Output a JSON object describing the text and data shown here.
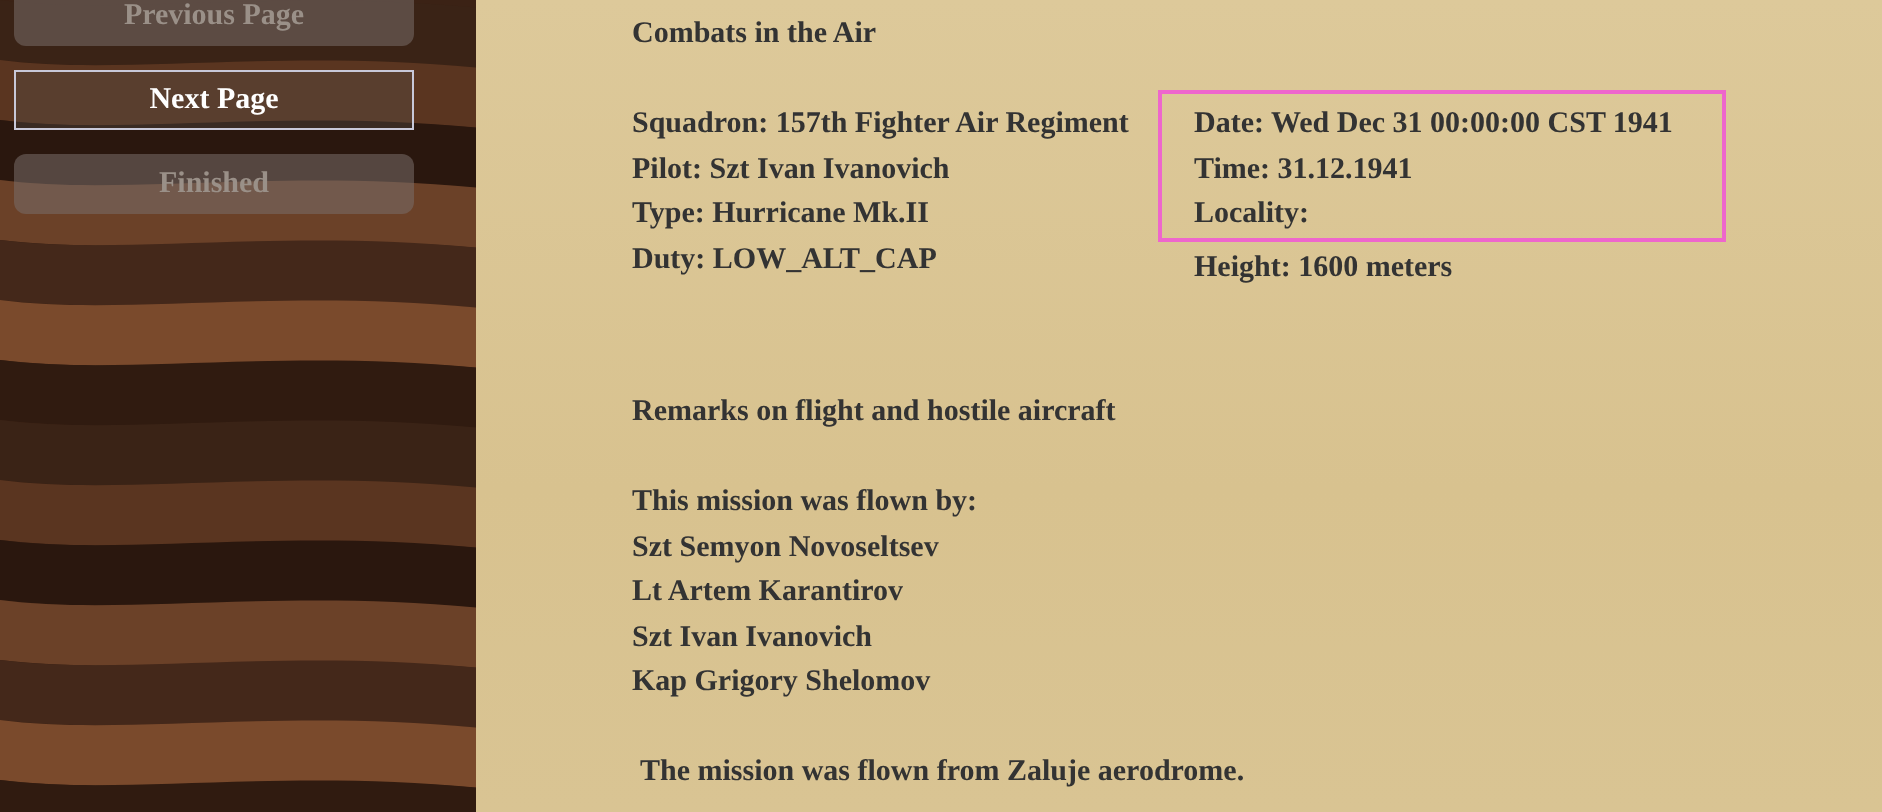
{
  "nav_buttons": [
    {
      "label": "Previous Page",
      "disabled": true
    },
    {
      "label": "Next Page",
      "disabled": false
    },
    {
      "label": "Finished",
      "disabled": true
    }
  ],
  "report": {
    "title": "Combats in the Air",
    "left_fields": [
      "Squadron: 157th Fighter Air Regiment",
      "Pilot: Szt Ivan Ivanovich",
      "Type: Hurricane Mk.II",
      "Duty: LOW_ALT_CAP"
    ],
    "right_groups": [
      {
        "highlighted": true,
        "lines": [
          "Date: Wed Dec 31 00:00:00 CST 1941",
          "Time: 31.12.1941",
          "Locality:"
        ]
      },
      {
        "highlighted": false,
        "lines": [
          "Height: 1600 meters"
        ]
      }
    ],
    "remarks_heading": "Remarks on flight and hostile aircraft",
    "flown_by_heading": "This mission was flown by:",
    "pilots": [
      "Szt Semyon Novoseltsev",
      "Lt Artem Karantirov",
      "Szt Ivan Ivanovich",
      "Kap Grigory Shelomov"
    ],
    "closing": "The mission was flown from Zaluje aerodrome."
  }
}
